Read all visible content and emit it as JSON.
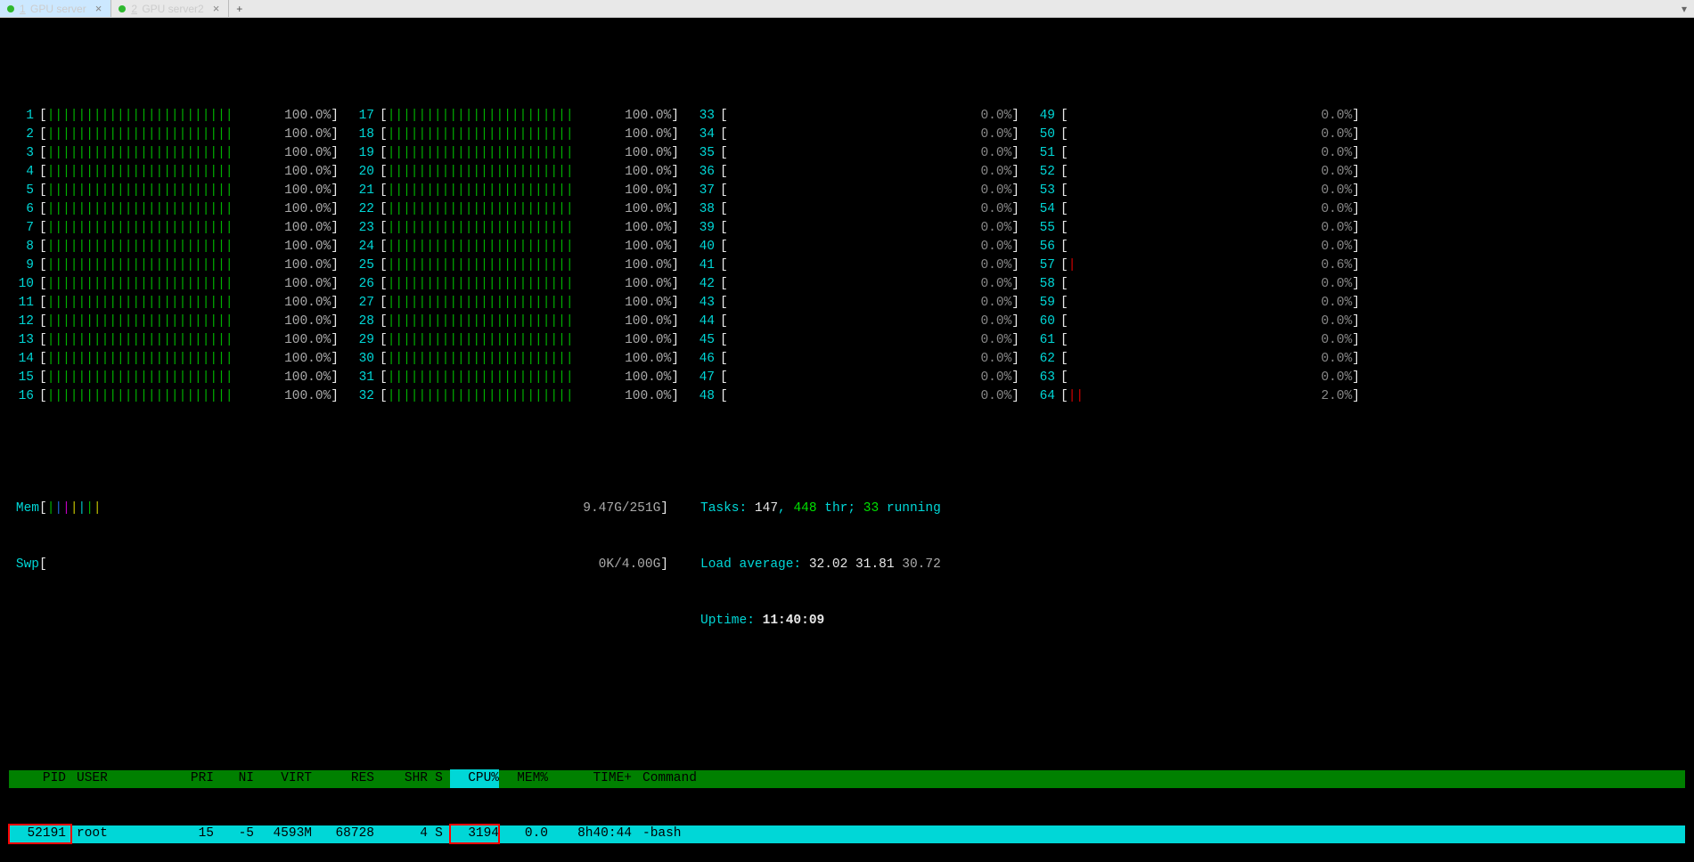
{
  "tabs": [
    {
      "num": "1",
      "label": "GPU server",
      "active": true
    },
    {
      "num": "2",
      "label": "GPU server2",
      "active": false
    }
  ],
  "cpu_cols": [
    [
      {
        "n": "1",
        "pct": "100.0%",
        "full": true
      },
      {
        "n": "2",
        "pct": "100.0%",
        "full": true
      },
      {
        "n": "3",
        "pct": "100.0%",
        "full": true
      },
      {
        "n": "4",
        "pct": "100.0%",
        "full": true
      },
      {
        "n": "5",
        "pct": "100.0%",
        "full": true
      },
      {
        "n": "6",
        "pct": "100.0%",
        "full": true
      },
      {
        "n": "7",
        "pct": "100.0%",
        "full": true
      },
      {
        "n": "8",
        "pct": "100.0%",
        "full": true
      },
      {
        "n": "9",
        "pct": "100.0%",
        "full": true
      },
      {
        "n": "10",
        "pct": "100.0%",
        "full": true
      },
      {
        "n": "11",
        "pct": "100.0%",
        "full": true
      },
      {
        "n": "12",
        "pct": "100.0%",
        "full": true
      },
      {
        "n": "13",
        "pct": "100.0%",
        "full": true
      },
      {
        "n": "14",
        "pct": "100.0%",
        "full": true
      },
      {
        "n": "15",
        "pct": "100.0%",
        "full": true
      },
      {
        "n": "16",
        "pct": "100.0%",
        "full": true
      }
    ],
    [
      {
        "n": "17",
        "pct": "100.0%",
        "full": true
      },
      {
        "n": "18",
        "pct": "100.0%",
        "full": true
      },
      {
        "n": "19",
        "pct": "100.0%",
        "full": true
      },
      {
        "n": "20",
        "pct": "100.0%",
        "full": true
      },
      {
        "n": "21",
        "pct": "100.0%",
        "full": true
      },
      {
        "n": "22",
        "pct": "100.0%",
        "full": true
      },
      {
        "n": "23",
        "pct": "100.0%",
        "full": true
      },
      {
        "n": "24",
        "pct": "100.0%",
        "full": true
      },
      {
        "n": "25",
        "pct": "100.0%",
        "full": true
      },
      {
        "n": "26",
        "pct": "100.0%",
        "full": true
      },
      {
        "n": "27",
        "pct": "100.0%",
        "full": true
      },
      {
        "n": "28",
        "pct": "100.0%",
        "full": true
      },
      {
        "n": "29",
        "pct": "100.0%",
        "full": true
      },
      {
        "n": "30",
        "pct": "100.0%",
        "full": true
      },
      {
        "n": "31",
        "pct": "100.0%",
        "full": true
      },
      {
        "n": "32",
        "pct": "100.0%",
        "full": true
      }
    ],
    [
      {
        "n": "33",
        "pct": "0.0%",
        "full": false
      },
      {
        "n": "34",
        "pct": "0.0%",
        "full": false
      },
      {
        "n": "35",
        "pct": "0.0%",
        "full": false
      },
      {
        "n": "36",
        "pct": "0.0%",
        "full": false
      },
      {
        "n": "37",
        "pct": "0.0%",
        "full": false
      },
      {
        "n": "38",
        "pct": "0.0%",
        "full": false
      },
      {
        "n": "39",
        "pct": "0.0%",
        "full": false
      },
      {
        "n": "40",
        "pct": "0.0%",
        "full": false
      },
      {
        "n": "41",
        "pct": "0.0%",
        "full": false
      },
      {
        "n": "42",
        "pct": "0.0%",
        "full": false
      },
      {
        "n": "43",
        "pct": "0.0%",
        "full": false
      },
      {
        "n": "44",
        "pct": "0.0%",
        "full": false
      },
      {
        "n": "45",
        "pct": "0.0%",
        "full": false
      },
      {
        "n": "46",
        "pct": "0.0%",
        "full": false
      },
      {
        "n": "47",
        "pct": "0.0%",
        "full": false
      },
      {
        "n": "48",
        "pct": "0.0%",
        "full": false
      }
    ],
    [
      {
        "n": "49",
        "pct": "0.0%",
        "full": false
      },
      {
        "n": "50",
        "pct": "0.0%",
        "full": false
      },
      {
        "n": "51",
        "pct": "0.0%",
        "full": false
      },
      {
        "n": "52",
        "pct": "0.0%",
        "full": false
      },
      {
        "n": "53",
        "pct": "0.0%",
        "full": false
      },
      {
        "n": "54",
        "pct": "0.0%",
        "full": false
      },
      {
        "n": "55",
        "pct": "0.0%",
        "full": false
      },
      {
        "n": "56",
        "pct": "0.0%",
        "full": false
      },
      {
        "n": "57",
        "pct": "0.6%",
        "full": false,
        "tick": 1
      },
      {
        "n": "58",
        "pct": "0.0%",
        "full": false
      },
      {
        "n": "59",
        "pct": "0.0%",
        "full": false
      },
      {
        "n": "60",
        "pct": "0.0%",
        "full": false
      },
      {
        "n": "61",
        "pct": "0.0%",
        "full": false
      },
      {
        "n": "62",
        "pct": "0.0%",
        "full": false
      },
      {
        "n": "63",
        "pct": "0.0%",
        "full": false
      },
      {
        "n": "64",
        "pct": "2.0%",
        "full": false,
        "tick": 2
      }
    ]
  ],
  "mem": {
    "label": "Mem",
    "used": "9.47G",
    "total": "251G"
  },
  "swp": {
    "label": "Swp",
    "used": "0K",
    "total": "4.00G"
  },
  "tasks": {
    "label": "Tasks: ",
    "procs": "147",
    "sep1": ", ",
    "thr": "448",
    "thr_lbl": " thr; ",
    "run": "33",
    "run_lbl": " running"
  },
  "load": {
    "label": "Load average: ",
    "l1": "32.02",
    "l2": "31.81",
    "l3": "30.72"
  },
  "uptime": {
    "label": "Uptime: ",
    "val": "11:40:09"
  },
  "header": {
    "pid": "PID",
    "user": "USER",
    "pri": "PRI",
    "ni": "NI",
    "virt": "VIRT",
    "res": "RES",
    "shr": "SHR",
    "s": "S",
    "cpu": "CPU%",
    "mem": "MEM%",
    "time": "TIME+",
    "cmd": "Command"
  },
  "proc": {
    "pid": "52191",
    "user": "root",
    "pri": "15",
    "ni": "-5",
    "virt": "4593M",
    "res": "68728",
    "shr": "4",
    "s": "S",
    "cpu": "3194",
    "mem": "0.0",
    "time": "8h40:44",
    "cmd": "-bash"
  }
}
